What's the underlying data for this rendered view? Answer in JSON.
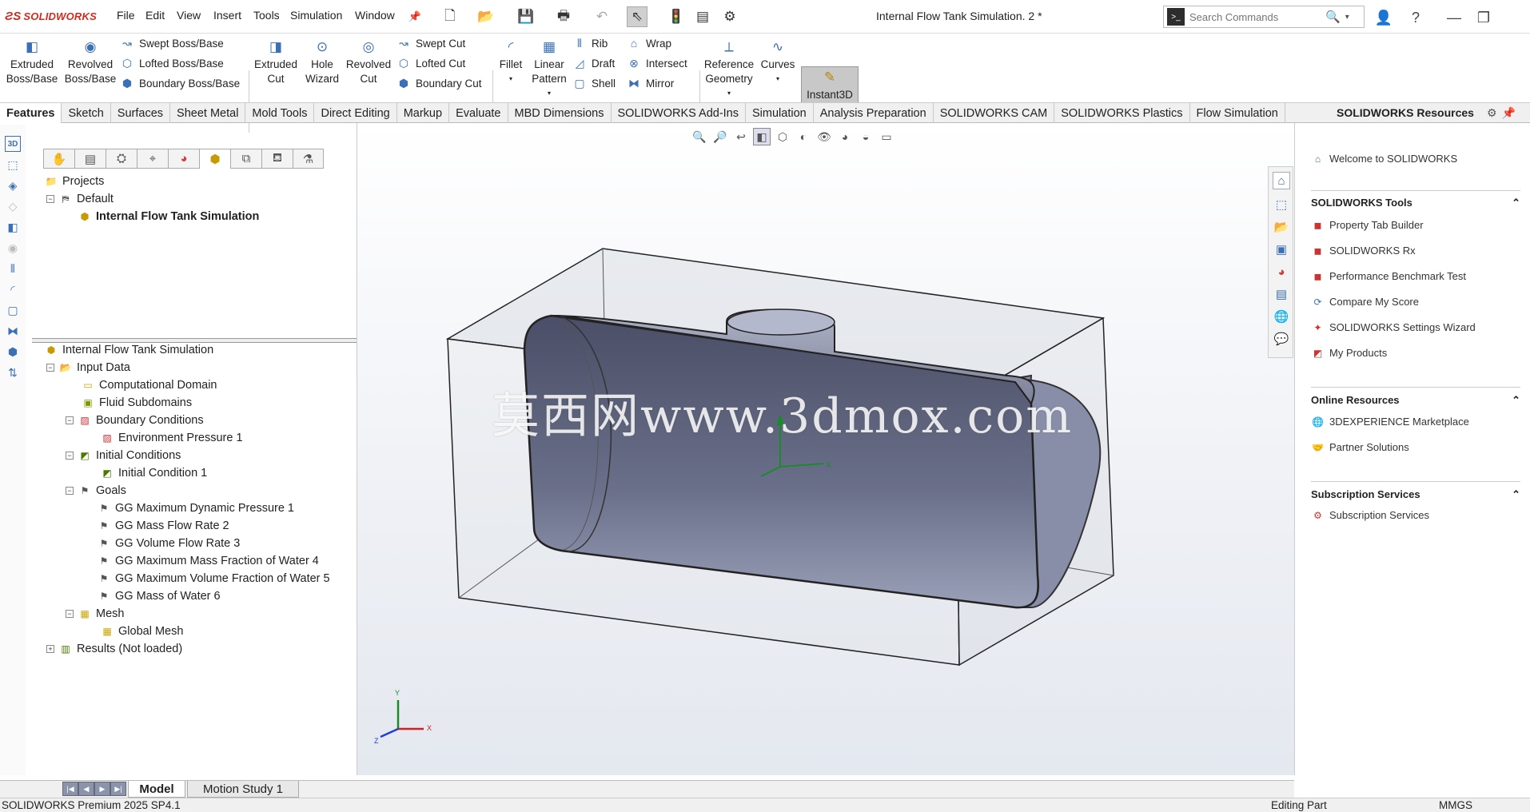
{
  "app": {
    "brand": "SOLIDWORKS",
    "window_title": "Internal Flow Tank Simulation. 2 *"
  },
  "menu": [
    "File",
    "Edit",
    "View",
    "Insert",
    "Tools",
    "Simulation",
    "Window"
  ],
  "search": {
    "placeholder": "Search Commands"
  },
  "ribbon": {
    "extruded_boss": "Extruded Boss/Base",
    "revolved_boss": "Revolved Boss/Base",
    "swept_boss": "Swept Boss/Base",
    "lofted_boss": "Lofted Boss/Base",
    "boundary_boss": "Boundary Boss/Base",
    "extruded_cut": "Extruded Cut",
    "hole_wizard": "Hole Wizard",
    "revolved_cut": "Revolved Cut",
    "swept_cut": "Swept Cut",
    "lofted_cut": "Lofted Cut",
    "boundary_cut": "Boundary Cut",
    "fillet": "Fillet",
    "linear_pattern": "Linear Pattern",
    "rib": "Rib",
    "draft": "Draft",
    "shell": "Shell",
    "wrap": "Wrap",
    "intersect": "Intersect",
    "mirror": "Mirror",
    "reference_geometry": "Reference Geometry",
    "curves": "Curves",
    "instant3d": "Instant3D"
  },
  "tabs": [
    "Features",
    "Sketch",
    "Surfaces",
    "Sheet Metal",
    "Mold Tools",
    "Direct Editing",
    "Markup",
    "Evaluate",
    "MBD Dimensions",
    "SOLIDWORKS Add-Ins",
    "Simulation",
    "Analysis Preparation",
    "SOLIDWORKS CAM",
    "SOLIDWORKS Plastics",
    "Flow Simulation"
  ],
  "resources_title": "SOLIDWORKS Resources",
  "projects_tree": {
    "root": "Projects",
    "config": "Default",
    "project": "Internal Flow Tank Simulation"
  },
  "analysis_tree": {
    "root": "Internal Flow Tank Simulation",
    "input_data": "Input Data",
    "computational_domain": "Computational Domain",
    "fluid_subdomains": "Fluid Subdomains",
    "boundary_conditions": "Boundary Conditions",
    "environment_pressure": "Environment Pressure 1",
    "initial_conditions": "Initial Conditions",
    "initial_condition_1": "Initial Condition 1",
    "goals": "Goals",
    "goal_1": "GG Maximum Dynamic Pressure 1",
    "goal_2": "GG Mass Flow Rate 2",
    "goal_3": "GG Volume Flow Rate 3",
    "goal_4": "GG Maximum Mass Fraction of Water 4",
    "goal_5": "GG Maximum Volume Fraction of Water 5",
    "goal_6": "GG Mass of Water 6",
    "mesh": "Mesh",
    "global_mesh": "Global Mesh",
    "results": "Results (Not loaded)"
  },
  "watermark": "莫西网www.3dmox.com",
  "triad": {
    "x": "X",
    "y": "Y",
    "z": "Z"
  },
  "resources": {
    "welcome": "Welcome to SOLIDWORKS",
    "tools_header": "SOLIDWORKS Tools",
    "tools": [
      "Property Tab Builder",
      "SOLIDWORKS Rx",
      "Performance Benchmark Test",
      "Compare My Score",
      "SOLIDWORKS Settings Wizard",
      "My Products"
    ],
    "online_header": "Online Resources",
    "online": [
      "3DEXPERIENCE Marketplace",
      "Partner Solutions"
    ],
    "subscription_header": "Subscription Services",
    "subscription": [
      "Subscription Services"
    ]
  },
  "bottom_tabs": {
    "model": "Model",
    "motion": "Motion Study 1"
  },
  "status": {
    "product": "SOLIDWORKS Premium 2025 SP4.1",
    "mode": "Editing Part",
    "units": "MMGS"
  }
}
